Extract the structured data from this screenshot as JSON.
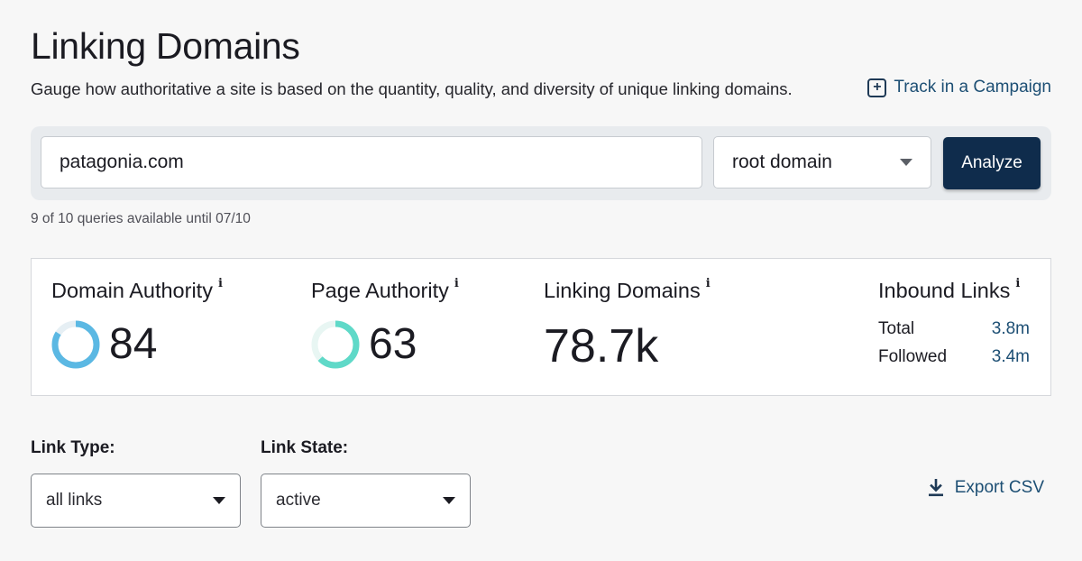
{
  "header": {
    "title": "Linking Domains",
    "subtitle": "Gauge how authoritative a site is based on the quantity, quality, and diversity of unique linking domains.",
    "track_link": "Track in a Campaign"
  },
  "search": {
    "domain_value": "patagonia.com",
    "scope_selected": "root domain",
    "analyze_label": "Analyze",
    "quota_text": "9 of 10 queries available until 07/10"
  },
  "metrics": {
    "domain_authority": {
      "label": "Domain Authority",
      "value": "84",
      "score": 84,
      "color": "#5bb8e3"
    },
    "page_authority": {
      "label": "Page Authority",
      "value": "63",
      "score": 63,
      "color": "#5fd9c8"
    },
    "linking_domains": {
      "label": "Linking Domains",
      "value": "78.7k"
    },
    "inbound_links": {
      "label": "Inbound Links",
      "total_label": "Total",
      "total_value": "3.8m",
      "followed_label": "Followed",
      "followed_value": "3.4m"
    },
    "info_glyph": "i"
  },
  "filters": {
    "link_type_label": "Link Type:",
    "link_type_selected": "all links",
    "link_state_label": "Link State:",
    "link_state_selected": "active",
    "export_label": "Export CSV"
  },
  "colors": {
    "accent_dark": "#0f2c4c",
    "link": "#1d4f74"
  }
}
